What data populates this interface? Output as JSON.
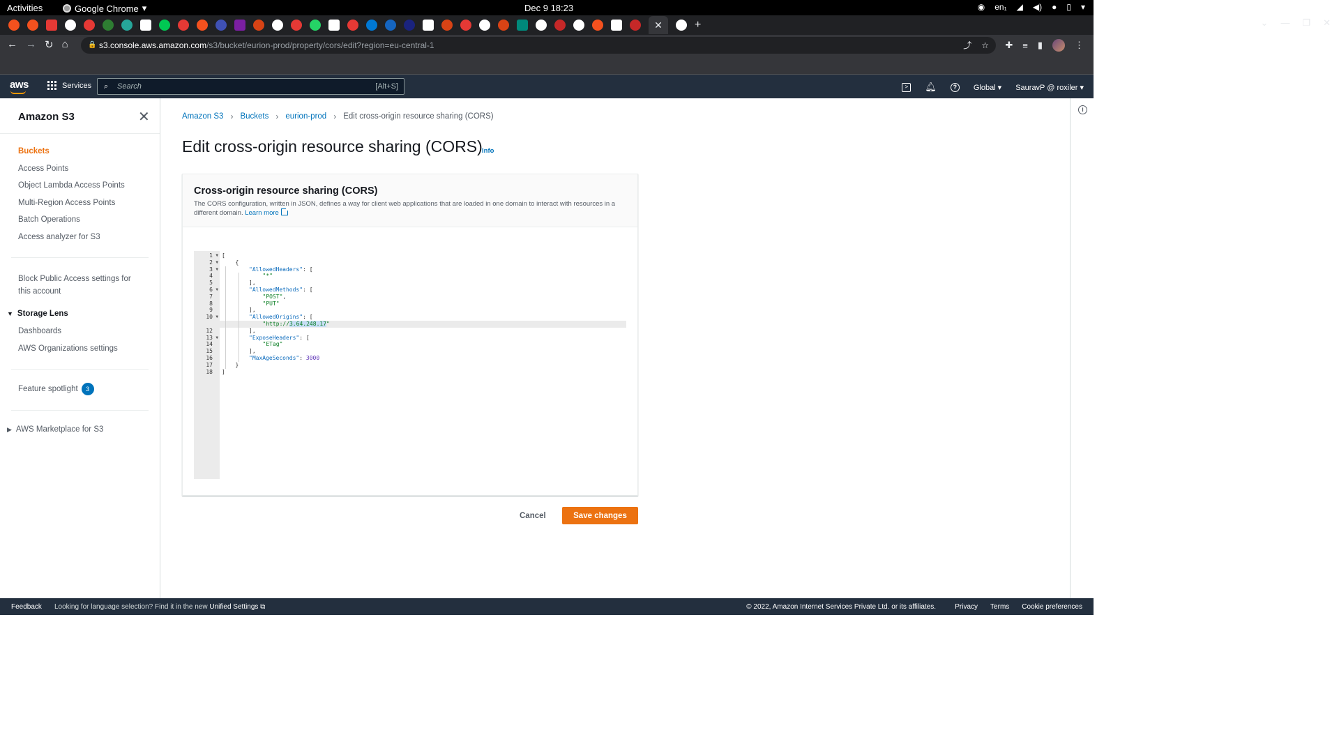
{
  "system": {
    "activities": "Activities",
    "app_name": "Google Chrome",
    "clock": "Dec 9  18:23",
    "lang": "en₁"
  },
  "browser": {
    "url_host": "s3.console.aws.amazon.com",
    "url_path": "/s3/bucket/eurion-prod/property/cors/edit?region=eu-central-1",
    "tab_colors": [
      "#f4511e",
      "#f4511e",
      "#e53935",
      "#fff",
      "#e53935",
      "#2e7d32",
      "#26a69a",
      "#fff",
      "#00c853",
      "#e53935",
      "#f4511e",
      "#3f51b5",
      "#7b1fa2",
      "#d84315",
      "#fff",
      "#e53935",
      "#25d366",
      "#fff",
      "#e53935",
      "#0078d4",
      "#1565c0",
      "#1a237e",
      "#fff",
      "#d84315",
      "#e53935",
      "#fff",
      "#d84315",
      "#00897b",
      "#fff",
      "#c62828",
      "#fff",
      "#f4511e",
      "#fff",
      "#c62828",
      "#fff"
    ]
  },
  "aws": {
    "logo": "aws",
    "services": "Services",
    "search_placeholder": "Search",
    "search_hint": "[Alt+S]",
    "region": "Global ▾",
    "account": "SauravP @ roxiler ▾"
  },
  "sidenav": {
    "title": "Amazon S3",
    "items": [
      {
        "label": "Buckets",
        "active": true
      },
      {
        "label": "Access Points"
      },
      {
        "label": "Object Lambda Access Points"
      },
      {
        "label": "Multi-Region Access Points"
      },
      {
        "label": "Batch Operations"
      },
      {
        "label": "Access analyzer for S3"
      }
    ],
    "block_public": "Block Public Access settings for this account",
    "storage_lens": "Storage Lens",
    "storage_lens_items": [
      "Dashboards",
      "AWS Organizations settings"
    ],
    "feature_spotlight": "Feature spotlight",
    "feature_count": "3",
    "marketplace": "AWS Marketplace for S3"
  },
  "breadcrumb": {
    "items": [
      "Amazon S3",
      "Buckets",
      "eurion-prod"
    ],
    "current": "Edit cross-origin resource sharing (CORS)"
  },
  "page": {
    "title": "Edit cross-origin resource sharing (CORS)",
    "info": "Info"
  },
  "panel": {
    "title": "Cross-origin resource sharing (CORS)",
    "description": "The CORS configuration, written in JSON, defines a way for client web applications that are loaded in one domain to interact with resources in a different domain.",
    "learn_more": "Learn more"
  },
  "editor": {
    "lines": [
      {
        "n": "1",
        "fold": true,
        "indent": 0,
        "parts": [
          [
            "p",
            "["
          ]
        ]
      },
      {
        "n": "2",
        "fold": true,
        "indent": 1,
        "parts": [
          [
            "p",
            "{"
          ]
        ]
      },
      {
        "n": "3",
        "fold": true,
        "indent": 2,
        "parts": [
          [
            "k",
            "\"AllowedHeaders\""
          ],
          [
            "p",
            ": ["
          ]
        ]
      },
      {
        "n": "4",
        "indent": 3,
        "parts": [
          [
            "s",
            "\"*\""
          ]
        ]
      },
      {
        "n": "5",
        "indent": 2,
        "parts": [
          [
            "p",
            "],"
          ]
        ]
      },
      {
        "n": "6",
        "fold": true,
        "indent": 2,
        "parts": [
          [
            "k",
            "\"AllowedMethods\""
          ],
          [
            "p",
            ": ["
          ]
        ]
      },
      {
        "n": "7",
        "indent": 3,
        "parts": [
          [
            "s",
            "\"POST\""
          ],
          [
            "p",
            ","
          ]
        ]
      },
      {
        "n": "8",
        "indent": 3,
        "parts": [
          [
            "s",
            "\"PUT\""
          ]
        ]
      },
      {
        "n": "9",
        "indent": 2,
        "parts": [
          [
            "p",
            "],"
          ]
        ]
      },
      {
        "n": "10",
        "fold": true,
        "indent": 2,
        "parts": [
          [
            "k",
            "\"AllowedOrigins\""
          ],
          [
            "p",
            ": ["
          ]
        ]
      },
      {
        "n": "11",
        "indent": 3,
        "highlight": true,
        "parts": [
          [
            "s",
            "\"http://"
          ],
          [
            "sel",
            "3.64.248.17"
          ],
          [
            "s",
            "\""
          ]
        ]
      },
      {
        "n": "12",
        "indent": 2,
        "parts": [
          [
            "p",
            "],"
          ]
        ]
      },
      {
        "n": "13",
        "fold": true,
        "indent": 2,
        "parts": [
          [
            "k",
            "\"ExposeHeaders\""
          ],
          [
            "p",
            ": ["
          ]
        ]
      },
      {
        "n": "14",
        "indent": 3,
        "parts": [
          [
            "s",
            "\"ETag\""
          ]
        ]
      },
      {
        "n": "15",
        "indent": 2,
        "parts": [
          [
            "p",
            "],"
          ]
        ]
      },
      {
        "n": "16",
        "indent": 2,
        "parts": [
          [
            "k",
            "\"MaxAgeSeconds\""
          ],
          [
            "p",
            ": "
          ],
          [
            "n",
            "3000"
          ]
        ]
      },
      {
        "n": "17",
        "indent": 1,
        "parts": [
          [
            "p",
            "}"
          ]
        ]
      },
      {
        "n": "18",
        "indent": 0,
        "parts": [
          [
            "p",
            "]"
          ]
        ]
      }
    ]
  },
  "actions": {
    "cancel": "Cancel",
    "save": "Save changes"
  },
  "footer": {
    "feedback": "Feedback",
    "lang_text": "Looking for language selection? Find it in the new",
    "unified": "Unified Settings",
    "copyright": "© 2022, Amazon Internet Services Private Ltd. or its affiliates.",
    "links": [
      "Privacy",
      "Terms",
      "Cookie preferences"
    ]
  }
}
